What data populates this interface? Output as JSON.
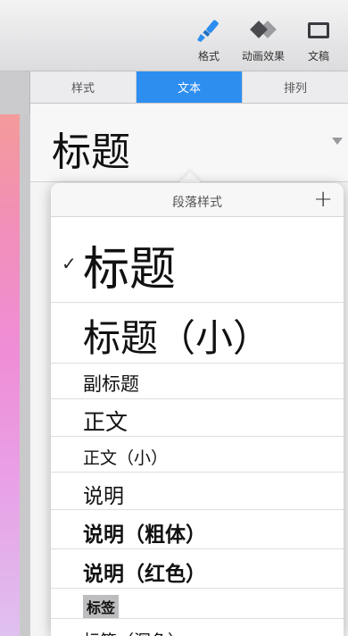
{
  "toolbar": {
    "format_label": "格式",
    "animation_label": "动画效果",
    "document_label": "文稿",
    "icons": [
      "paintbrush-icon",
      "animation-diamonds-icon",
      "document-icon"
    ]
  },
  "inspector": {
    "tabs": [
      {
        "label": "样式",
        "active": false
      },
      {
        "label": "文本",
        "active": true
      },
      {
        "label": "排列",
        "active": false
      }
    ],
    "current_style": "标题"
  },
  "popover": {
    "title": "段落样式",
    "add_label": "+",
    "styles": [
      {
        "label": "标题",
        "selected": true
      },
      {
        "label": "标题（小）",
        "selected": false
      },
      {
        "label": "副标题",
        "selected": false
      },
      {
        "label": "正文",
        "selected": false
      },
      {
        "label": "正文（小）",
        "selected": false
      },
      {
        "label": "说明",
        "selected": false
      },
      {
        "label": "说明（粗体）",
        "selected": false
      },
      {
        "label": "说明（红色）",
        "selected": false
      },
      {
        "label": "标签",
        "selected": false
      },
      {
        "label": "标签（深色）",
        "selected": false
      }
    ],
    "check_mark": "✓"
  },
  "colors": {
    "accent": "#2d8ef0",
    "red_style": "#d92b1c"
  }
}
